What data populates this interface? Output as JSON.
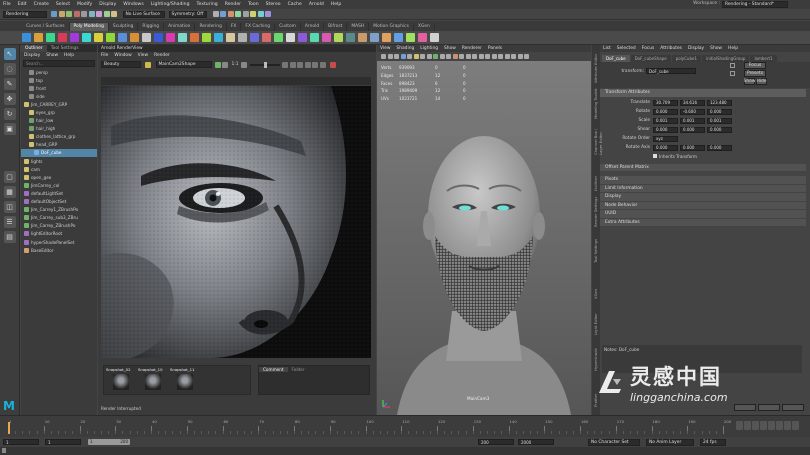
{
  "menubar": [
    "File",
    "Edit",
    "Create",
    "Select",
    "Modify",
    "Display",
    "Windows",
    "Lighting/Shading",
    "Texturing",
    "Render",
    "Toon",
    "Stereo",
    "Cache",
    "Arnold",
    "Help"
  ],
  "workspace": {
    "label": "Workspace :",
    "value": "Rendering - Standard*"
  },
  "statusline": {
    "mode": "Rendering",
    "live_surface": "No Live Surface",
    "symmetry": "Symmetry: Off"
  },
  "shelf_tabs": [
    "Curves / Surfaces",
    "Poly Modeling",
    "Sculpting",
    "Rigging",
    "Animation",
    "Rendering",
    "FX",
    "FX Caching",
    "Custom",
    "Arnold",
    "Bifrost",
    "MASH",
    "Motion Graphics",
    "XGen"
  ],
  "shelf_active": "Poly Modeling",
  "outliner": {
    "tabs": [
      "Outliner",
      "Tool Settings"
    ],
    "menu": [
      "Display",
      "Show",
      "Help"
    ],
    "search_placeholder": "Search...",
    "items": [
      {
        "label": "persp",
        "sel": false,
        "indent": 1
      },
      {
        "label": "top",
        "sel": false,
        "indent": 1
      },
      {
        "label": "front",
        "sel": false,
        "indent": 1
      },
      {
        "label": "side",
        "sel": false,
        "indent": 1
      },
      {
        "label": "Jim_CARREY_GRP",
        "sel": false,
        "indent": 0
      },
      {
        "label": "eyes_grp",
        "sel": false,
        "indent": 1
      },
      {
        "label": "hair_low",
        "sel": false,
        "indent": 1
      },
      {
        "label": "hair_high",
        "sel": false,
        "indent": 1
      },
      {
        "label": "clothes_lattice_grp",
        "sel": false,
        "indent": 1
      },
      {
        "label": "head_GRP",
        "sel": false,
        "indent": 1
      },
      {
        "label": "DoF_cube",
        "sel": true,
        "indent": 2
      },
      {
        "label": "lights",
        "sel": false,
        "indent": 0
      },
      {
        "label": "cam",
        "sel": false,
        "indent": 0
      },
      {
        "label": "open_geo",
        "sel": false,
        "indent": 0
      },
      {
        "label": "JimCarrey_col",
        "sel": false,
        "indent": 0
      },
      {
        "label": "defaultLightSet",
        "sel": false,
        "indent": 0
      },
      {
        "label": "defaultObjectSet",
        "sel": false,
        "indent": 0
      },
      {
        "label": "Jim_Carrey1_ZBrushPo",
        "sel": false,
        "indent": 0
      },
      {
        "label": "Jim_Carrey_sub3_ZBru",
        "sel": false,
        "indent": 0
      },
      {
        "label": "Jim_Carrey_ZBrushPo",
        "sel": false,
        "indent": 0
      },
      {
        "label": "lightEditorRoot",
        "sel": false,
        "indent": 0
      },
      {
        "label": "hyperShadePanelSet",
        "sel": false,
        "indent": 0
      },
      {
        "label": "BaseEditor",
        "sel": false,
        "indent": 0
      }
    ]
  },
  "renderview": {
    "title": "Arnold RenderView",
    "menu": [
      "File",
      "Window",
      "View",
      "Render"
    ],
    "display_mode": "Beauty",
    "camera": "MainCam2Shape",
    "ratio": "1:1",
    "snapshots": [
      "Snapshot_02",
      "Snapshot_10",
      "Snapshot_11"
    ],
    "comment_tabs": [
      "Comment",
      "Folder"
    ],
    "status": "Render Interrupted"
  },
  "viewport": {
    "menu": [
      "View",
      "Shading",
      "Lighting",
      "Show",
      "Renderer",
      "Panels"
    ],
    "hud_rows": [
      {
        "label": "Verts",
        "a": "939093",
        "b": "0",
        "c": "0"
      },
      {
        "label": "Edges",
        "a": "1837213",
        "b": "12",
        "c": "0"
      },
      {
        "label": "Faces",
        "a": "898423",
        "b": "6",
        "c": "0"
      },
      {
        "label": "Tris",
        "a": "1989409",
        "b": "12",
        "c": "0"
      },
      {
        "label": "UVs",
        "a": "1023721",
        "b": "14",
        "c": "0"
      }
    ],
    "camera_label": "MainCam3"
  },
  "attr": {
    "menu": [
      "List",
      "Selected",
      "Focus",
      "Attributes",
      "Display",
      "Show",
      "Help"
    ],
    "node_tabs": [
      "DoF_cube",
      "DoF_cubeShape",
      "polyCube1",
      "initialShadingGroup",
      "lambert1"
    ],
    "transform_label": "transform:",
    "transform_value": "DoF_cube",
    "buttons": [
      "Focus",
      "Presets",
      "Show",
      "Hide"
    ],
    "sections": [
      {
        "label": "Transform Attributes",
        "open": true
      },
      {
        "label": "Offset Parent Matrix",
        "open": false
      },
      {
        "label": "Pivots",
        "open": false
      },
      {
        "label": "Limit Information",
        "open": false
      },
      {
        "label": "Display",
        "open": false
      },
      {
        "label": "Node Behavior",
        "open": false
      },
      {
        "label": "UUID",
        "open": false
      },
      {
        "label": "Extra Attributes",
        "open": false
      }
    ],
    "rows": [
      {
        "label": "Translate",
        "v": [
          "30.709",
          "34.616",
          "123.480"
        ]
      },
      {
        "label": "Rotate",
        "v": [
          "0.000",
          "-0.600",
          "0.000"
        ]
      },
      {
        "label": "Scale",
        "v": [
          "0.001",
          "0.001",
          "0.001"
        ]
      },
      {
        "label": "Shear",
        "v": [
          "0.000",
          "0.000",
          "0.000"
        ]
      },
      {
        "label": "Rotate Order",
        "v": [
          "xyz"
        ]
      },
      {
        "label": "Rotate Axis",
        "v": [
          "0.000",
          "0.000",
          "0.000"
        ]
      }
    ],
    "inherits": "Inherits Transform",
    "notes": "Notes:  DoF_cube",
    "side_tabs": [
      "Attribute Editor",
      "Modeling Toolkit",
      "Channel Box / Layer Editor",
      "Outliner",
      "Render Settings",
      "Tool Settings",
      "XGen",
      "Light Editor",
      "Hypershade",
      "Profiler"
    ]
  },
  "timeline": {
    "ticks": [
      "1",
      "10",
      "20",
      "30",
      "40",
      "50",
      "60",
      "70",
      "80",
      "90",
      "100",
      "110",
      "120",
      "130",
      "140",
      "150",
      "160",
      "170",
      "180",
      "190",
      "200"
    ],
    "current": "1"
  },
  "range": {
    "start": "1",
    "start2": "1",
    "inner_start": "1",
    "inner_end": "200",
    "end_a": "200",
    "end_b": "2000",
    "char_set": "No Character Set",
    "anim_layer": "No Anim Layer",
    "fps": "24 fps"
  },
  "watermark": {
    "site": "lingganchina.com",
    "cn": "灵感中国"
  },
  "colors": {
    "accent": "#5285a6",
    "bg": "#444444",
    "panel": "#3b3b3b"
  }
}
